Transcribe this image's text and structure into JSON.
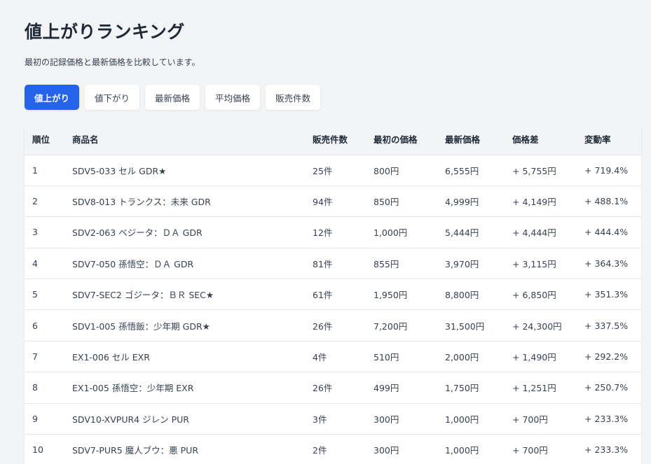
{
  "page": {
    "title": "値上がりランキング",
    "subtitle": "最初の記録価格と最新価格を比較しています。"
  },
  "tabs": [
    {
      "label": "値上がり",
      "active": true
    },
    {
      "label": "値下がり",
      "active": false
    },
    {
      "label": "最新価格",
      "active": false
    },
    {
      "label": "平均価格",
      "active": false
    },
    {
      "label": "販売件数",
      "active": false
    }
  ],
  "table": {
    "headers": [
      "順位",
      "商品名",
      "販売件数",
      "最初の価格",
      "最新価格",
      "価格差",
      "変動率"
    ],
    "rows": [
      [
        "1",
        "SDV5-033 セル GDR★",
        "25件",
        "800円",
        "6,555円",
        "+ 5,755円",
        "+ 719.4%"
      ],
      [
        "2",
        "SDV8-013 トランクス：未来 GDR",
        "94件",
        "850円",
        "4,999円",
        "+ 4,149円",
        "+ 488.1%"
      ],
      [
        "3",
        "SDV2-063 ベジータ：ＤＡ GDR",
        "12件",
        "1,000円",
        "5,444円",
        "+ 4,444円",
        "+ 444.4%"
      ],
      [
        "4",
        "SDV7-050 孫悟空：ＤＡ GDR",
        "81件",
        "855円",
        "3,970円",
        "+ 3,115円",
        "+ 364.3%"
      ],
      [
        "5",
        "SDV7-SEC2 ゴジータ：ＢＲ SEC★",
        "61件",
        "1,950円",
        "8,800円",
        "+ 6,850円",
        "+ 351.3%"
      ],
      [
        "6",
        "SDV1-005 孫悟飯：少年期 GDR★",
        "26件",
        "7,200円",
        "31,500円",
        "+ 24,300円",
        "+ 337.5%"
      ],
      [
        "7",
        "EX1-006 セル EXR",
        "4件",
        "510円",
        "2,000円",
        "+ 1,490円",
        "+ 292.2%"
      ],
      [
        "8",
        "EX1-005 孫悟空：少年期 EXR",
        "26件",
        "499円",
        "1,750円",
        "+ 1,251円",
        "+ 250.7%"
      ],
      [
        "9",
        "SDV10-XVPUR4 ジレン PUR",
        "3件",
        "300円",
        "1,000円",
        "+ 700円",
        "+ 233.3%"
      ],
      [
        "10",
        "SDV7-PUR5 魔人ブウ：悪 PUR",
        "2件",
        "300円",
        "1,000円",
        "+ 700円",
        "+ 233.3%"
      ]
    ]
  },
  "colors": {
    "accent": "#2563eb",
    "background": "#f3f4f6",
    "text": "#1f2937"
  }
}
